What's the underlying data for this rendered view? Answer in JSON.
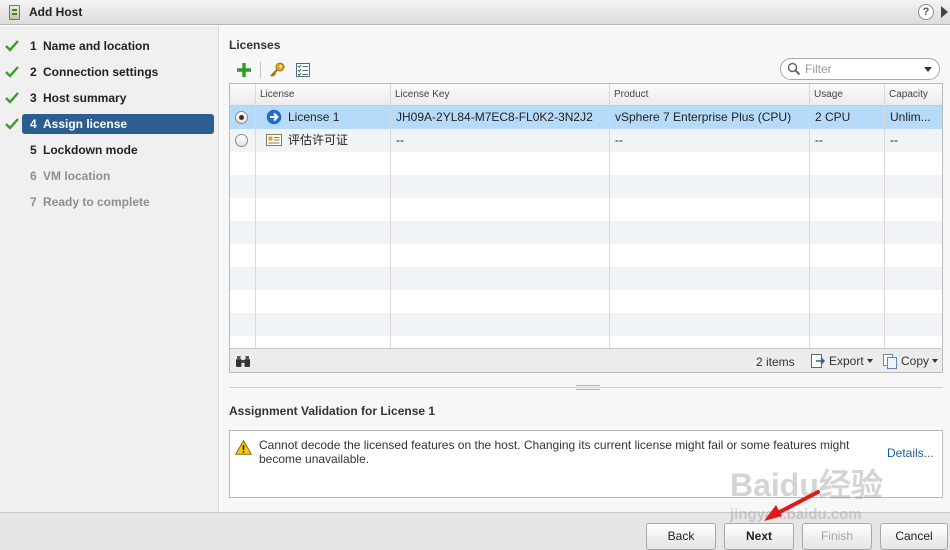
{
  "window": {
    "title": "Add Host",
    "help_label": "?"
  },
  "steps": [
    {
      "num": "1",
      "label": "Name and location",
      "state": "done"
    },
    {
      "num": "2",
      "label": "Connection settings",
      "state": "done"
    },
    {
      "num": "3",
      "label": "Host summary",
      "state": "done"
    },
    {
      "num": "4",
      "label": "Assign license",
      "state": "active"
    },
    {
      "num": "5",
      "label": "Lockdown mode",
      "state": "enabled"
    },
    {
      "num": "6",
      "label": "VM location",
      "state": "disabled"
    },
    {
      "num": "7",
      "label": "Ready to complete",
      "state": "disabled"
    }
  ],
  "licenses": {
    "section_title": "Licenses",
    "toolbar": [
      "add-icon",
      "key-icon",
      "checklist-icon"
    ],
    "filter_placeholder": "Filter",
    "columns": [
      "License",
      "License Key",
      "Product",
      "Usage",
      "Capacity"
    ],
    "rows": [
      {
        "selected": true,
        "icon": "arrow-right-circle-icon",
        "license": "License 1",
        "key": "JH09A-2YL84-M7EC8-FL0K2-3N2J2",
        "product": "vSphere 7 Enterprise Plus (CPU)",
        "usage": "2 CPU",
        "capacity": "Unlim..."
      },
      {
        "selected": false,
        "icon": "license-card-icon",
        "license": "评估许可证",
        "key": "--",
        "product": "--",
        "usage": "--",
        "capacity": "--"
      }
    ],
    "footer": {
      "items_count": "2 items",
      "export_label": "Export",
      "copy_label": "Copy"
    }
  },
  "validation": {
    "title": "Assignment Validation for License 1",
    "message": "Cannot decode the licensed features on the host. Changing its current license might fail or some features might become unavailable.",
    "details_link": "Details..."
  },
  "buttons": {
    "back": "Back",
    "next": "Next",
    "finish": "Finish",
    "cancel": "Cancel"
  },
  "watermark": {
    "brand": "Baidu经验",
    "site": "jingyan.baidu.com"
  },
  "colors": {
    "active_step": "#2c5f8f",
    "selected_row": "#b6dbfa",
    "check": "#3d9a2e",
    "link": "#1a5f9e",
    "annotation_arrow": "#e01a1a"
  }
}
